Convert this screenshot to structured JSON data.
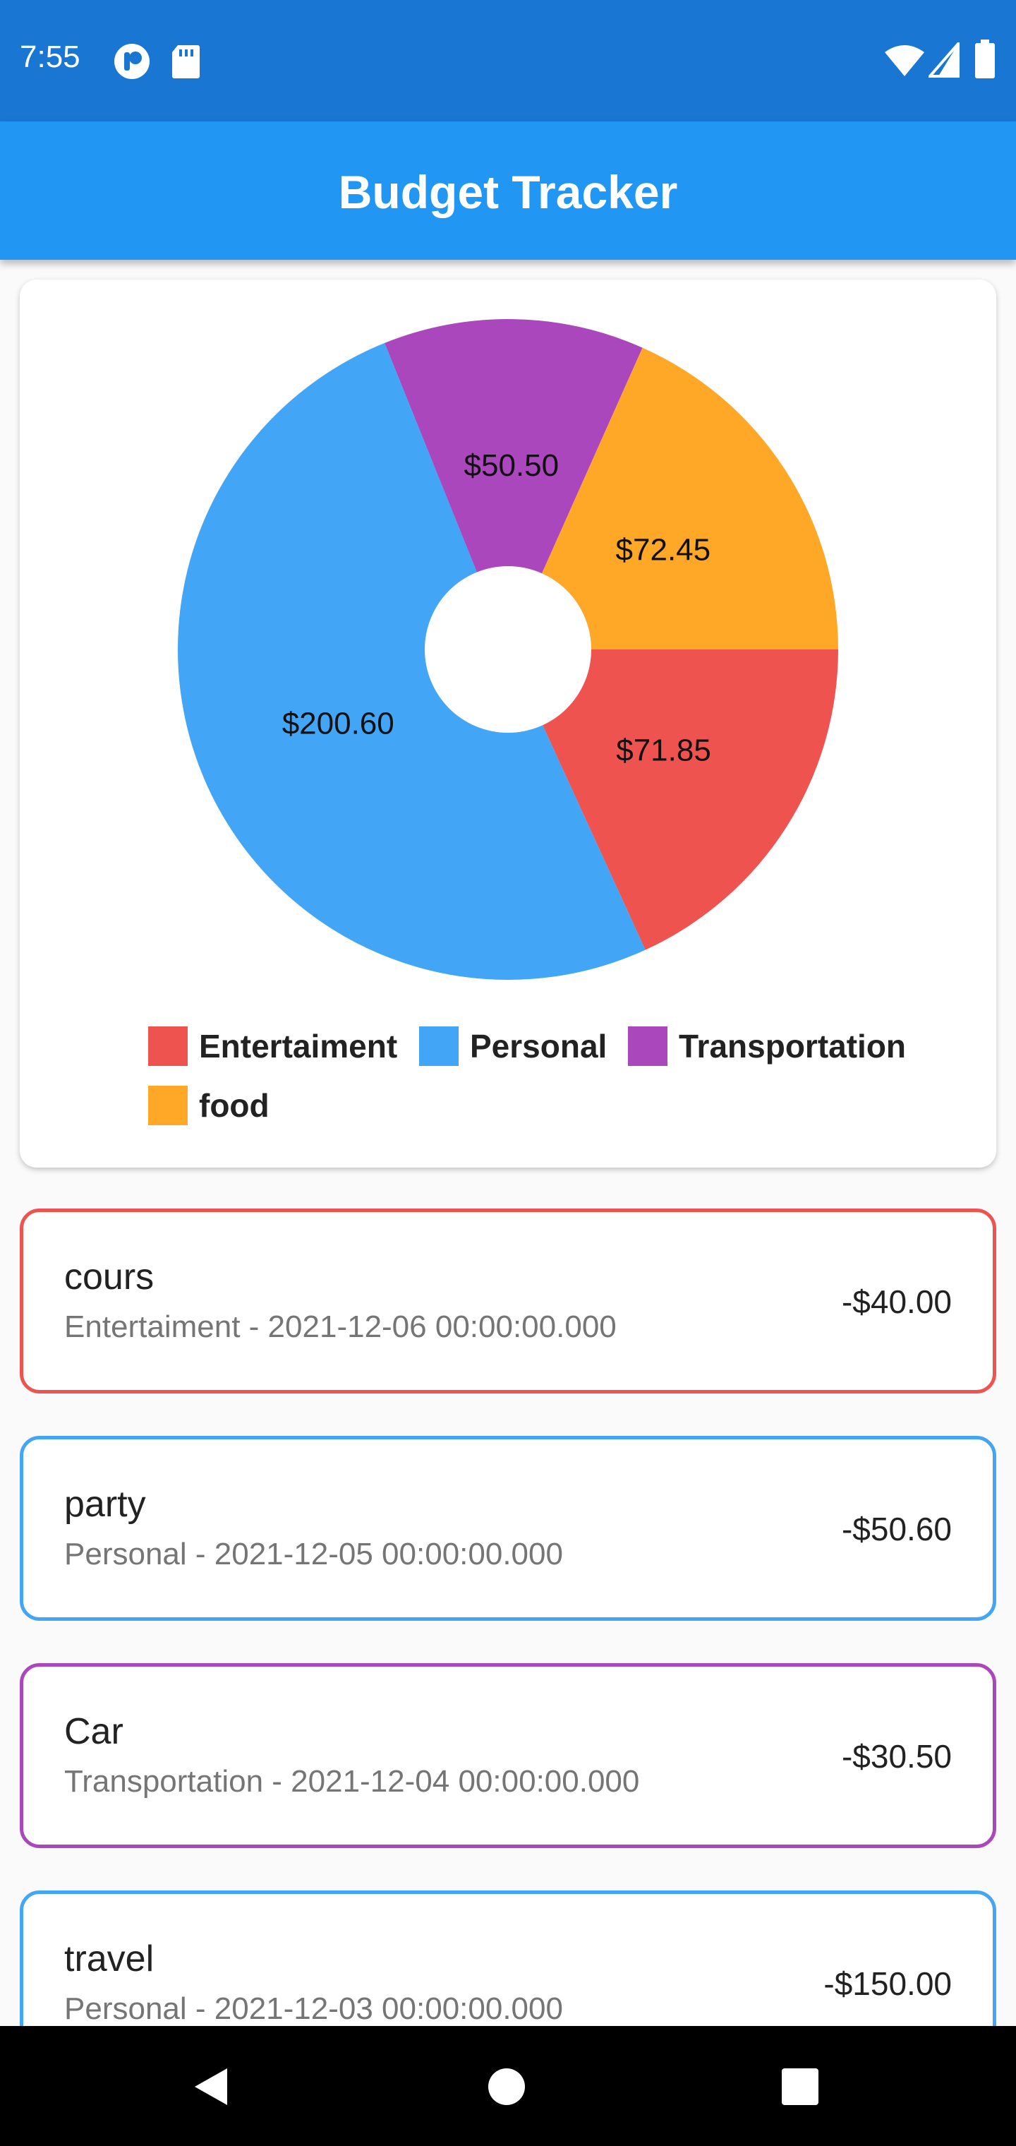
{
  "status_bar": {
    "time": "7:55"
  },
  "app_bar": {
    "title": "Budget Tracker"
  },
  "chart_data": {
    "type": "pie",
    "title": "",
    "donut": true,
    "slices": [
      {
        "name": "Entertaiment",
        "value": 71.85,
        "label": "$71.85",
        "color": "#ef5350"
      },
      {
        "name": "Personal",
        "value": 200.6,
        "label": "$200.60",
        "color": "#42a5f5"
      },
      {
        "name": "Transportation",
        "value": 50.5,
        "label": "$50.50",
        "color": "#ab47bc"
      },
      {
        "name": "food",
        "value": 72.45,
        "label": "$72.45",
        "color": "#ffa726"
      }
    ],
    "legend_position": "bottom"
  },
  "legend": [
    {
      "label": "Entertaiment",
      "color": "#ef5350"
    },
    {
      "label": "Personal",
      "color": "#42a5f5"
    },
    {
      "label": "Transportation",
      "color": "#ab47bc"
    },
    {
      "label": "food",
      "color": "#ffa726"
    }
  ],
  "transactions": [
    {
      "title": "cours",
      "subtitle": "Entertaiment - 2021-12-06 00:00:00.000",
      "amount": "-$40.00",
      "color": "#ef5350"
    },
    {
      "title": "party",
      "subtitle": "Personal - 2021-12-05 00:00:00.000",
      "amount": "-$50.60",
      "color": "#42a5f5"
    },
    {
      "title": "Car",
      "subtitle": "Transportation - 2021-12-04 00:00:00.000",
      "amount": "-$30.50",
      "color": "#ab47bc"
    },
    {
      "title": "travel",
      "subtitle": "Personal - 2021-12-03 00:00:00.000",
      "amount": "-$150.00",
      "color": "#42a5f5"
    }
  ],
  "icons": {
    "status_left": [
      "app-notification-icon",
      "sd-card-icon"
    ],
    "status_right": [
      "wifi-icon",
      "signal-icon",
      "battery-icon"
    ],
    "nav": [
      "back-icon",
      "home-icon",
      "recents-icon"
    ]
  }
}
